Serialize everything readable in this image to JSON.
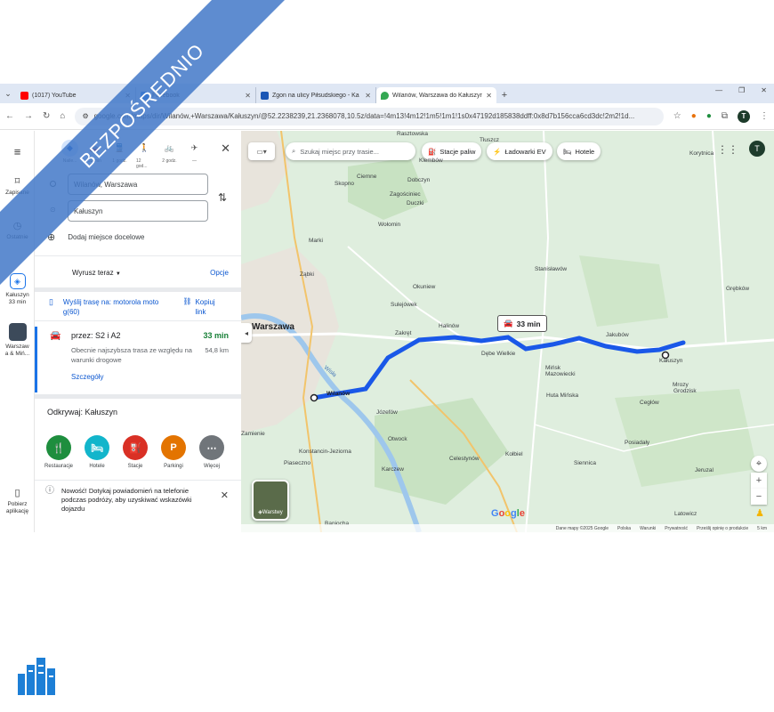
{
  "browser": {
    "tabs": [
      {
        "title": "(1017) YouTube",
        "favicon_color": "#ff0000"
      },
      {
        "title": "Facebook",
        "favicon_color": "#1877f2"
      },
      {
        "title": "Zgon na ulicy Piłsudskiego - Ka",
        "favicon_color": "#1a56b5"
      },
      {
        "title": "Wilanów, Warszawa do Kałuszyn",
        "favicon_color": "#34a853"
      }
    ],
    "url": "google.com/maps/dir/Wilanów,+Warszawa/Kałuszyn/@52.2238239,21.2368078,10.5z/data=!4m13!4m12!1m5!1m1!1s0x47192d185838ddff:0x8d7b156cca6cd3dc!2m2!1d...",
    "profile_initial": "T"
  },
  "rail": {
    "saved": "Zapisane",
    "recent": "Ostatnie",
    "current_route": "Kałuszyn\n33 min",
    "pinned": "Warszaw\na & Miń...",
    "get_app": "Pobierz\naplikację"
  },
  "directions": {
    "modes": [
      {
        "label": "Naile...",
        "icon": "◆"
      },
      {
        "label": "33 min",
        "icon": "🚗"
      },
      {
        "label": "1 godz.",
        "icon": "🚆"
      },
      {
        "label": "12 god...",
        "icon": "🚶"
      },
      {
        "label": "2 godz.",
        "icon": "🚲"
      },
      {
        "label": "—",
        "icon": "✈"
      }
    ],
    "from": "Wilanów, Warszawa",
    "to": "Kałuszyn",
    "add_destination": "Dodaj miejsce docelowe",
    "depart": "Wyrusz teraz",
    "options": "Opcje",
    "send_route": "Wyślij trasę na: motorola moto g(60)",
    "copy_link": "Kopiuj link",
    "route": {
      "via": "przez: S2 i A2",
      "time": "33 min",
      "description": "Obecnie najszybsza trasa ze względu na warunki drogowe",
      "distance": "54,8 km",
      "details": "Szczegóły"
    },
    "explore_title": "Odkrywaj: Kałuszyn",
    "categories": [
      {
        "label": "Restauracje",
        "color": "#1e8e3e",
        "icon": "🍴"
      },
      {
        "label": "Hotele",
        "color": "#12b5cb",
        "icon": "🛏"
      },
      {
        "label": "Stacje",
        "color": "#d93025",
        "icon": "⛽"
      },
      {
        "label": "Parkingi",
        "color": "#e37400",
        "icon": "P"
      },
      {
        "label": "Więcej",
        "color": "#70757a",
        "icon": "⋯"
      }
    ],
    "notice": "Nowość! Dotykaj powiadomień na telefonie podczas podróży, aby uzyskiwać wskazówki dojazdu"
  },
  "map": {
    "search_placeholder": "Szukaj miejsc przy trasie...",
    "chips": [
      "Stacje paliw",
      "Ładowarki EV",
      "Hotele"
    ],
    "route_badge": "33 min",
    "layers_label": "Warstwy",
    "google": "Google",
    "attribution": [
      "Dane mapy ©2025 Google",
      "Polska",
      "Warunki",
      "Prywatność",
      "Prześlij opinię o produkcie",
      "5 km"
    ],
    "places": [
      {
        "name": "Warszawa",
        "cls": "big bold"
      },
      {
        "name": "Wilanów",
        "cls": "bold"
      },
      {
        "name": "Kałuszyn",
        "cls": ""
      },
      {
        "name": "Klembów",
        "cls": ""
      },
      {
        "name": "Rasztowska",
        "cls": ""
      },
      {
        "name": "Tłuszcz",
        "cls": ""
      },
      {
        "name": "Korytnica",
        "cls": ""
      },
      {
        "name": "Dobczyn",
        "cls": ""
      },
      {
        "name": "Ciemne",
        "cls": ""
      },
      {
        "name": "Skopno",
        "cls": ""
      },
      {
        "name": "Zagościniec",
        "cls": ""
      },
      {
        "name": "Duczki",
        "cls": ""
      },
      {
        "name": "Wołomin",
        "cls": ""
      },
      {
        "name": "Marki",
        "cls": ""
      },
      {
        "name": "Ząbki",
        "cls": ""
      },
      {
        "name": "Okuniew",
        "cls": ""
      },
      {
        "name": "Sulejówek",
        "cls": ""
      },
      {
        "name": "Halinów",
        "cls": ""
      },
      {
        "name": "Zakręt",
        "cls": ""
      },
      {
        "name": "Dębe Wielkie",
        "cls": ""
      },
      {
        "name": "Stanisławów",
        "cls": ""
      },
      {
        "name": "Jakubów",
        "cls": ""
      },
      {
        "name": "Mińsk Mazowiecki",
        "cls": ""
      },
      {
        "name": "Huta Mińska",
        "cls": ""
      },
      {
        "name": "Mrozy",
        "cls": ""
      },
      {
        "name": "Grodzisk",
        "cls": ""
      },
      {
        "name": "Cegłów",
        "cls": ""
      },
      {
        "name": "Józefów",
        "cls": ""
      },
      {
        "name": "Otwock",
        "cls": ""
      },
      {
        "name": "Konstancin-Jeziorna",
        "cls": ""
      },
      {
        "name": "Piaseczno",
        "cls": ""
      },
      {
        "name": "Karczew",
        "cls": ""
      },
      {
        "name": "Celestynów",
        "cls": ""
      },
      {
        "name": "Kołbiel",
        "cls": ""
      },
      {
        "name": "Siennica",
        "cls": ""
      },
      {
        "name": "Posiadały",
        "cls": ""
      },
      {
        "name": "Jeruzal",
        "cls": ""
      },
      {
        "name": "Latowicz",
        "cls": ""
      },
      {
        "name": "Grębków",
        "cls": ""
      },
      {
        "name": "Zamienie",
        "cls": ""
      },
      {
        "name": "Baniocha",
        "cls": ""
      },
      {
        "name": "Wisła",
        "cls": ""
      }
    ]
  },
  "watermark": "BEZPOŚREDNIO"
}
